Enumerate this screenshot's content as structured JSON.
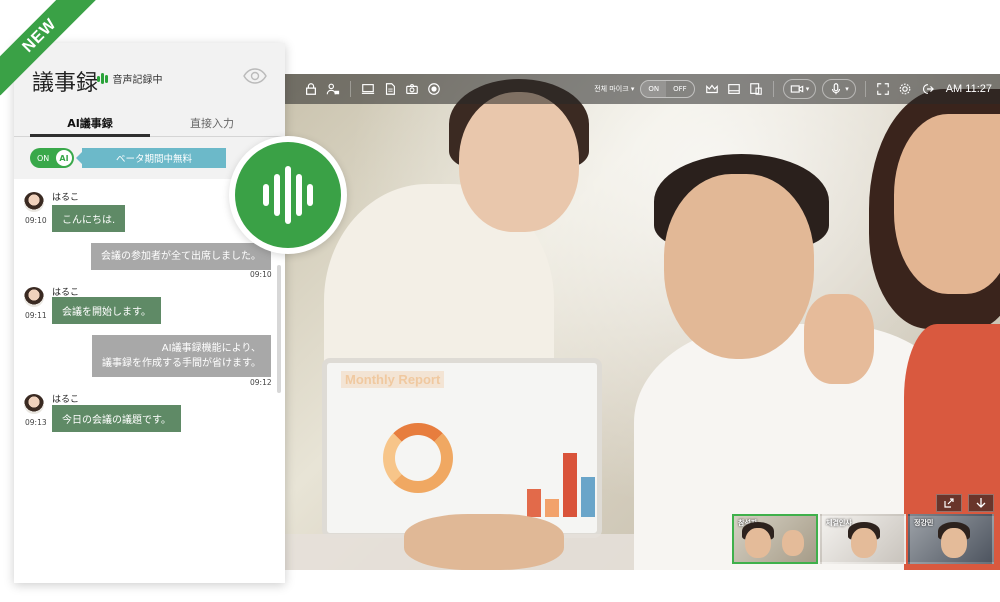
{
  "ribbon": {
    "label": "NEW"
  },
  "panel": {
    "title": "議事録",
    "recording_status": "音声記録中",
    "tabs": [
      {
        "label": "AI議事録",
        "active": true
      },
      {
        "label": "直接入力",
        "active": false
      }
    ],
    "ai_toggle": {
      "state": "ON",
      "knob_label": "AI"
    },
    "beta_notice": "ベータ期間中無料"
  },
  "chat": {
    "messages": [
      {
        "side": "left",
        "user": "はるこ",
        "time": "09:10",
        "text": "こんにちは."
      },
      {
        "side": "right",
        "time": "09:10",
        "text": "会議の参加者が全て出席しました。"
      },
      {
        "side": "left",
        "user": "はるこ",
        "time": "09:11",
        "text": "会議を開始します。"
      },
      {
        "side": "right",
        "time": "09:12",
        "lines": [
          "AI議事録機能により、",
          "議事録を作成する手間が省けます。"
        ]
      },
      {
        "side": "left",
        "user": "はるこ",
        "time": "09:13",
        "text": "今日の会議の議題です。"
      }
    ]
  },
  "video": {
    "toolbar": {
      "mic_mode_label": "전체 마이크 ▾",
      "toggle_on": "ON",
      "toggle_off": "OFF",
      "clock": "AM 11:27"
    },
    "laptop_screen_title": "Monthly Report",
    "thumbnails": [
      {
        "name": "참석자",
        "active": true
      },
      {
        "name": "체결인사",
        "active": false
      },
      {
        "name": "정강민",
        "active": false
      }
    ]
  },
  "colors": {
    "brand_green": "#3aa146",
    "chat_bubble_left": "#5f8a66",
    "chat_bubble_right": "#a8a8a8",
    "beta_badge": "#6cb9c9"
  }
}
